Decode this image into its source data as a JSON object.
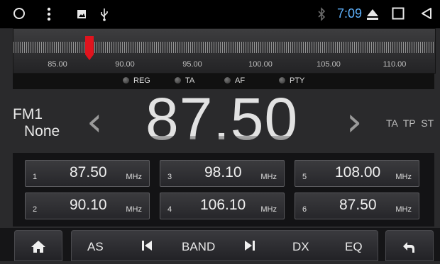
{
  "statusbar": {
    "time": "7:09",
    "icons": [
      "home-circle-icon",
      "more-vert-icon",
      "image-icon",
      "usb-icon",
      "bluetooth-icon",
      "eject-icon",
      "recents-square-icon",
      "back-triangle-icon"
    ]
  },
  "tuner": {
    "labels": [
      "85.00",
      "90.00",
      "95.00",
      "100.00",
      "105.00",
      "110.00"
    ],
    "flags": [
      "REG",
      "TA",
      "AF",
      "PTY"
    ]
  },
  "station": {
    "band": "FM1",
    "name": "None",
    "frequency": "87.50",
    "indicators": "TA TP ST"
  },
  "presets": [
    {
      "num": "1",
      "freq": "87.50",
      "unit": "MHz"
    },
    {
      "num": "3",
      "freq": "98.10",
      "unit": "MHz"
    },
    {
      "num": "5",
      "freq": "108.00",
      "unit": "MHz"
    },
    {
      "num": "2",
      "freq": "90.10",
      "unit": "MHz"
    },
    {
      "num": "4",
      "freq": "106.10",
      "unit": "MHz"
    },
    {
      "num": "6",
      "freq": "87.50",
      "unit": "MHz"
    }
  ],
  "controls": {
    "as": "AS",
    "band": "BAND",
    "dx": "DX",
    "eq": "EQ"
  },
  "colors": {
    "time": "#5fb3ff",
    "needle": "#e0141e"
  }
}
